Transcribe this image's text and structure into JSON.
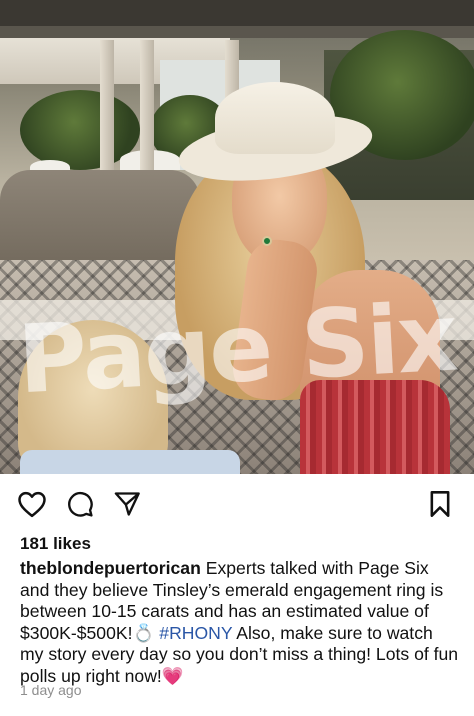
{
  "post": {
    "image_alt": "Woman in a wide-brim hat at an outdoor cafe",
    "watermark": "Page Six",
    "likes": "181 likes",
    "username": "theblondepuertorican",
    "caption_part1": " Experts talked with Page Six and they believe Tinsley’s emerald engagement ring is between 10-15 carats and has an estimated value of $300K-$500K!💍 ",
    "hashtag": "#RHONY",
    "caption_part2": " Also, make sure to watch my story every day so you don’t miss a thing! Lots of fun polls up right now!💗",
    "timestamp": "1 day ago"
  },
  "actions": {
    "like_icon": "heart-outline-icon",
    "comment_icon": "comment-bubble-icon",
    "share_icon": "paper-plane-icon",
    "save_icon": "bookmark-outline-icon"
  },
  "colors": {
    "text": "#111111",
    "hashtag": "#2a56a6",
    "muted": "#8e8e8e"
  }
}
